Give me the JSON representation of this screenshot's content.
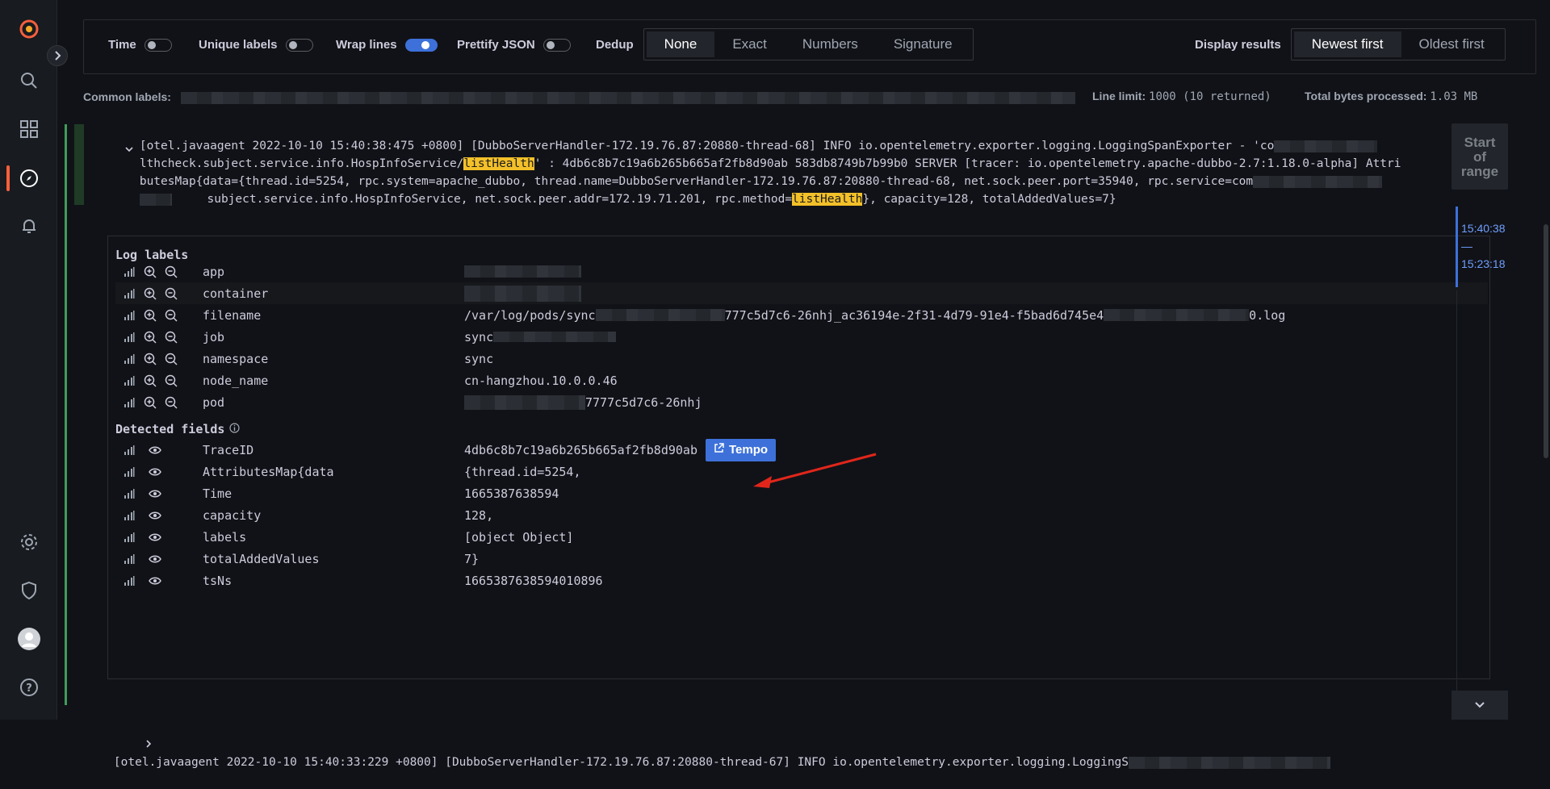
{
  "options": {
    "time_label": "Time",
    "unique_labels_label": "Unique labels",
    "wrap_lines_label": "Wrap lines",
    "prettify_json_label": "Prettify JSON",
    "dedup_label": "Dedup",
    "dedup_options": [
      "None",
      "Exact",
      "Numbers",
      "Signature"
    ],
    "display_results_label": "Display results",
    "sort_options": [
      "Newest first",
      "Oldest first"
    ]
  },
  "meta": {
    "common_labels_label": "Common labels:",
    "line_limit_label": "Line limit:",
    "line_limit_value": "1000 (10 returned)",
    "total_bytes_label": "Total bytes processed:",
    "total_bytes_value": "1.03 MB"
  },
  "log_entry": {
    "line1": "[otel.javaagent 2022-10-10 15:40:38:475 +0800] [DubboServerHandler-172.19.76.87:20880-thread-68] INFO io.opentelemetry.exporter.logging.LoggingSpanExporter - 'co",
    "line2_pre": "lthcheck.subject.service.info.HospInfoService/",
    "line2_hl": "listHealth",
    "line2_post": "' : 4db6c8b7c19a6b265b665af2fb8d90ab 583db8749b7b99b0 SERVER [tracer: io.opentelemetry.apache-dubbo-2.7:1.18.0-alpha] Attri",
    "line3": "butesMap{data={thread.id=5254, rpc.system=apache_dubbo, thread.name=DubboServerHandler-172.19.76.87:20880-thread-68, net.sock.peer.port=35940, rpc.service=com",
    "line4_pre": "     subject.service.info.HospInfoService, net.sock.peer.addr=172.19.71.201, rpc.method=",
    "line4_hl": "listHealth",
    "line4_post": "}, capacity=128, totalAddedValues=7}"
  },
  "log_labels_title": "Log labels",
  "log_labels": [
    {
      "key": "app",
      "value": ""
    },
    {
      "key": "container",
      "value": ""
    },
    {
      "key": "filename",
      "value_pre": "/var/log/pods/sync",
      "value_post": "777c5d7c6-26nhj_ac36194e-2f31-4d79-91e4-f5bad6d745e4",
      "value_end": "0.log"
    },
    {
      "key": "job",
      "value": "sync"
    },
    {
      "key": "namespace",
      "value": "sync"
    },
    {
      "key": "node_name",
      "value": "cn-hangzhou.10.0.0.46"
    },
    {
      "key": "pod",
      "value": "7777c5d7c6-26nhj"
    }
  ],
  "detected_fields_title": "Detected fields",
  "detected_fields": [
    {
      "key": "TraceID",
      "value": "4db6c8b7c19a6b265b665af2fb8d90ab"
    },
    {
      "key": "AttributesMap{data",
      "value": "{thread.id=5254,"
    },
    {
      "key": "Time",
      "value": "1665387638594"
    },
    {
      "key": "capacity",
      "value": "128,"
    },
    {
      "key": "labels",
      "value": "[object Object]"
    },
    {
      "key": "totalAddedValues",
      "value": "7}"
    },
    {
      "key": "tsNs",
      "value": "1665387638594010896"
    }
  ],
  "tempo_label": "Tempo",
  "next_log_line": "[otel.javaagent 2022-10-10 15:40:33:229 +0800] [DubboServerHandler-172.19.76.87:20880-thread-67] INFO io.opentelemetry.exporter.logging.LoggingS",
  "right_rail": {
    "start_of_range": "Start of range",
    "range_top": "15:40:38",
    "range_dash": "—",
    "range_bottom": "15:23:18"
  },
  "colors": {
    "accent": "#3d71d9",
    "highlight": "#f3c029",
    "brand": "#f55f3e"
  }
}
